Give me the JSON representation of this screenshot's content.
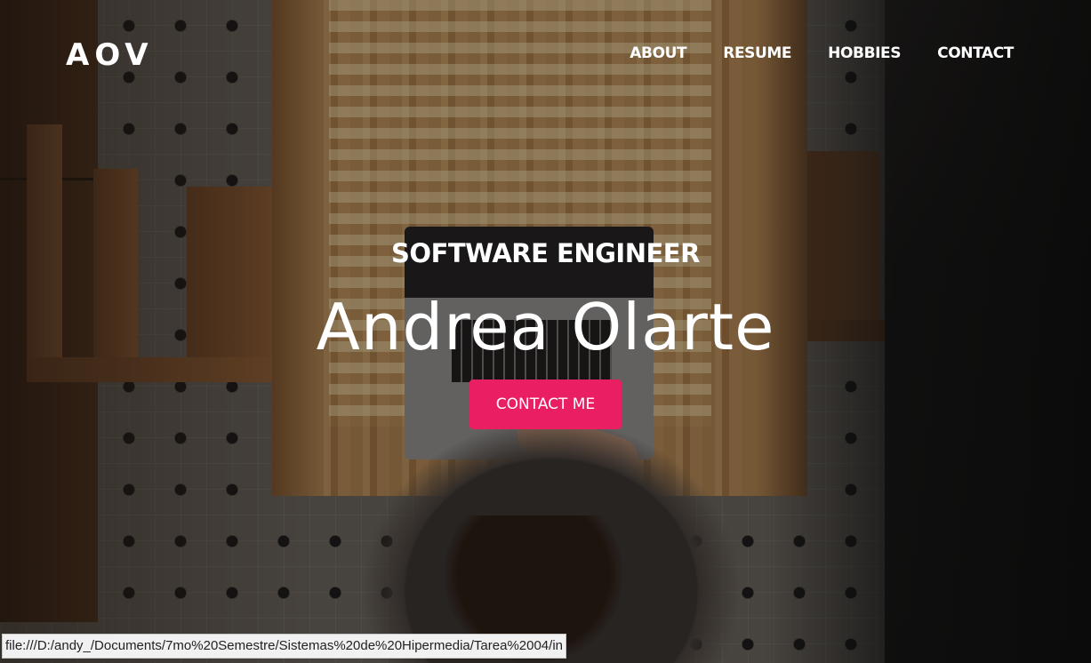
{
  "header": {
    "logo": "AOV",
    "nav": [
      "ABOUT",
      "RESUME",
      "HOBBIES",
      "CONTACT"
    ]
  },
  "hero": {
    "kicker": "SOFTWARE ENGINEER",
    "name": "Andrea Olarte",
    "cta_label": "CONTACT ME"
  },
  "status_bar": {
    "url": "file:///D:/andy_/Documents/7mo%20Semestre/Sistemas%20de%20Hipermedia/Tarea%2004/in"
  },
  "colors": {
    "accent": "#e91e63",
    "text": "#ffffff"
  }
}
